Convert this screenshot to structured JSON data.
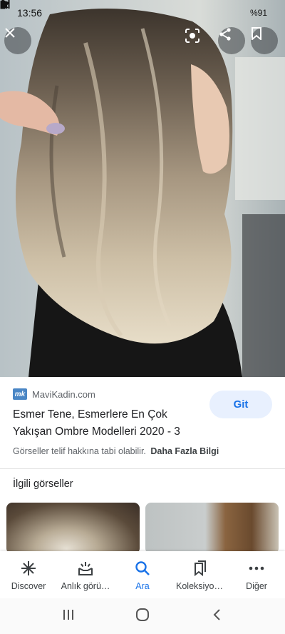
{
  "status_bar": {
    "time": "13:56",
    "battery_text": "%91"
  },
  "hero": {
    "icons": [
      "close-icon",
      "lens-icon",
      "share-icon",
      "bookmark-icon"
    ]
  },
  "result": {
    "source_logo_text": "mk",
    "source_name": "MaviKadin.com",
    "title": "Esmer Tene, Esmerlere En Çok Yakışan Ombre Modelleri 2020 - 3",
    "visit_button": "Git",
    "copyright_text": "Görseller telif hakkına tabi olabilir.",
    "more_info_link": "Daha Fazla Bilgi"
  },
  "related": {
    "heading": "İlgili görseller"
  },
  "bottom_nav": {
    "items": [
      {
        "label": "Discover",
        "icon": "asterisk-icon"
      },
      {
        "label": "Anlık görü…",
        "icon": "updates-icon"
      },
      {
        "label": "Ara",
        "icon": "search-icon"
      },
      {
        "label": "Koleksiyo…",
        "icon": "collections-icon"
      },
      {
        "label": "Diğer",
        "icon": "more-icon"
      }
    ],
    "active_index": 2,
    "active_color": "#1a73e8"
  },
  "system_nav": {
    "icons": [
      "recents-icon",
      "home-icon",
      "back-icon"
    ]
  }
}
